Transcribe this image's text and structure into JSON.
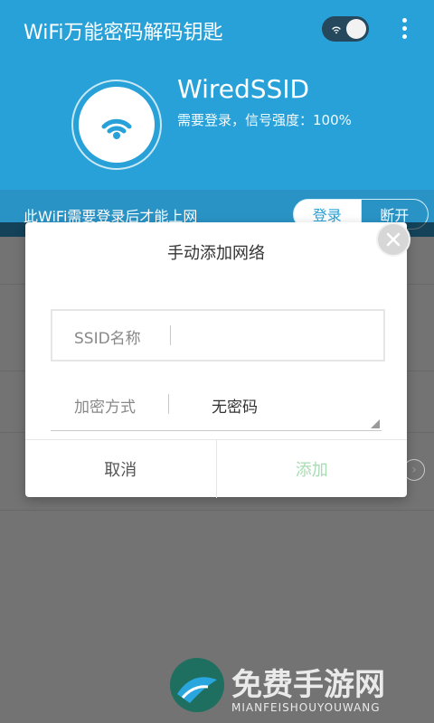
{
  "appbar": {
    "title": "WiFi万能密码解码钥匙",
    "icons": {
      "wifi": "wifi-icon",
      "more": "more-vert-icon"
    }
  },
  "header": {
    "ssid": "WiredSSID",
    "subtitle": "需要登录，信号强度：100%"
  },
  "status_row": {
    "message": "此WiFi需要登录后才能上网",
    "login_label": "登录",
    "disconnect_label": "断开"
  },
  "dialog": {
    "title": "手动添加网络",
    "ssid": {
      "label": "SSID名称",
      "value": ""
    },
    "encryption": {
      "label": "加密方式",
      "value": "无密码"
    },
    "cancel_label": "取消",
    "add_label": "添加",
    "close_icon": "close-icon"
  },
  "watermark": {
    "title": "免费手游网",
    "subtitle": "MIANFEISHOUYOUWANG"
  },
  "colors": {
    "primary": "#27a1d8",
    "status_bar": "#2a93c6",
    "add_disabled": "#a8dcb4",
    "overlay": "rgba(0,0,0,0.55)"
  }
}
